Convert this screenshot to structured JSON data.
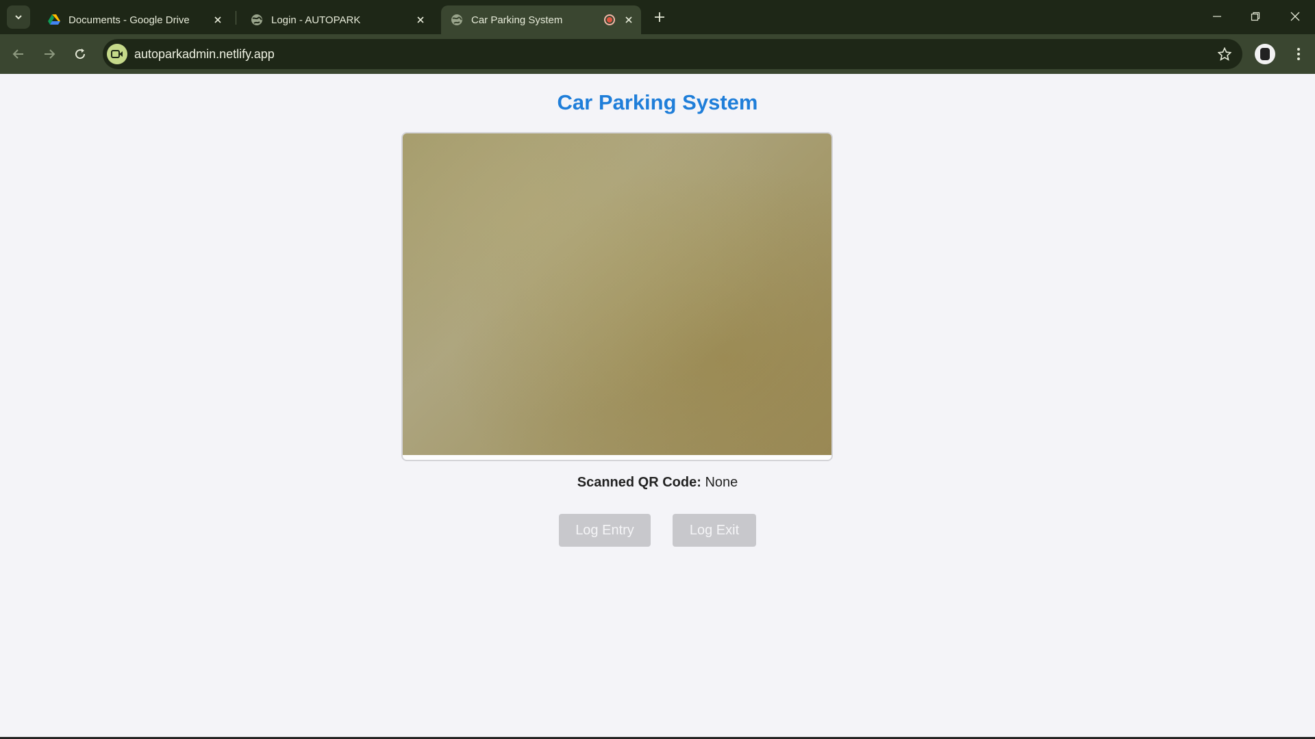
{
  "browser": {
    "tabs": [
      {
        "title": "Documents - Google Drive",
        "icon": "google-drive-icon"
      },
      {
        "title": "Login - AUTOPARK",
        "icon": "globe-icon"
      },
      {
        "title": "Car Parking System",
        "icon": "globe-icon",
        "active": true,
        "recording": true
      }
    ],
    "url": "autoparkadmin.netlify.app",
    "site_icon": "camera-in-use-icon",
    "colors": {
      "frame": "#1e2717",
      "toolbar": "#3a4630",
      "site_chip": "#c5d98a"
    }
  },
  "page": {
    "title": "Car Parking System",
    "title_color": "#1f7ed9",
    "qr_label": "Scanned QR Code:",
    "qr_value": "None",
    "buttons": {
      "log_entry": "Log Entry",
      "log_exit": "Log Exit"
    },
    "button_color": "#c8c8cc"
  }
}
